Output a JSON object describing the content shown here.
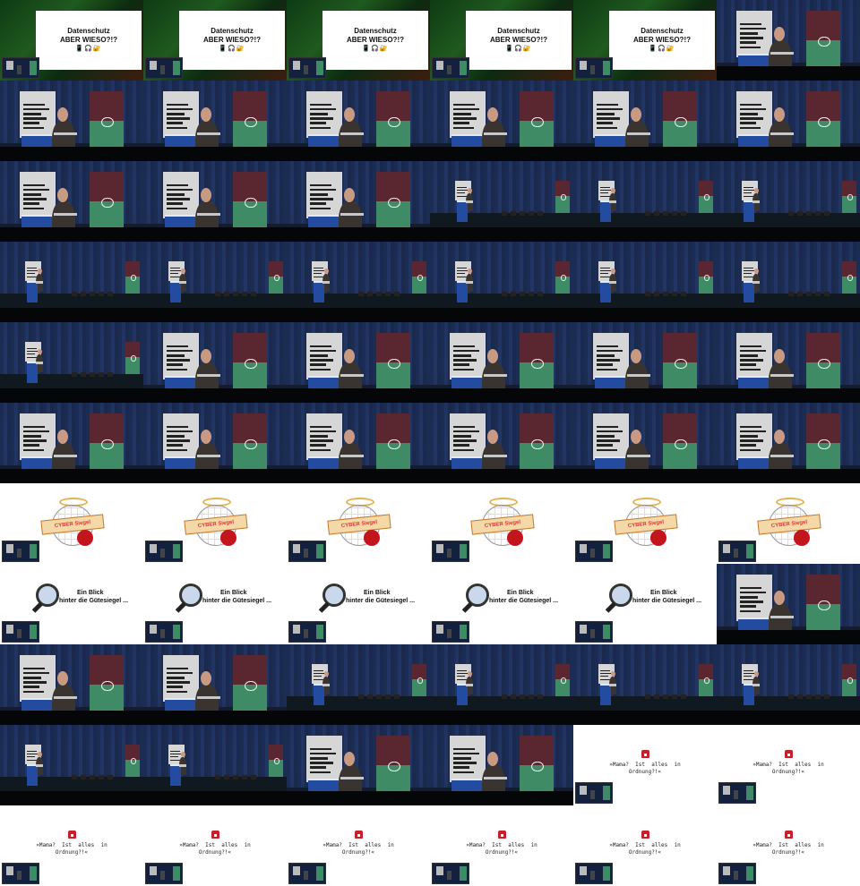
{
  "title_slide": {
    "line1": "Datenschutz",
    "line2": "ABER WIESO?!?",
    "emojis": "📱🎧🔐"
  },
  "seal_slide": {
    "banner": "CYBER Siegel"
  },
  "magnifier_slide": {
    "line1": "Ein Blick",
    "line2": "hinter die Gütesiegel ..."
  },
  "quote_slide": {
    "text": "»Mama?  Ist  alles  in\nOrdnung?!«"
  },
  "frames": [
    "title",
    "title",
    "title",
    "title",
    "title",
    "close",
    "close",
    "close",
    "close",
    "close",
    "close",
    "close",
    "close",
    "close",
    "close",
    "wide",
    "wide",
    "wide",
    "wide",
    "wide",
    "wide",
    "wide",
    "wide",
    "wide",
    "wide",
    "close",
    "close",
    "close",
    "close",
    "close",
    "close",
    "close",
    "close",
    "close",
    "close",
    "close",
    "seal",
    "seal",
    "seal",
    "seal",
    "seal",
    "seal",
    "magnifier",
    "magnifier",
    "magnifier",
    "magnifier",
    "magnifier",
    "close",
    "close",
    "close",
    "wide",
    "wide",
    "wide",
    "wide",
    "wide",
    "wide",
    "close",
    "close",
    "quote",
    "quote",
    "quote",
    "quote",
    "quote",
    "quote",
    "quote",
    "quote"
  ]
}
